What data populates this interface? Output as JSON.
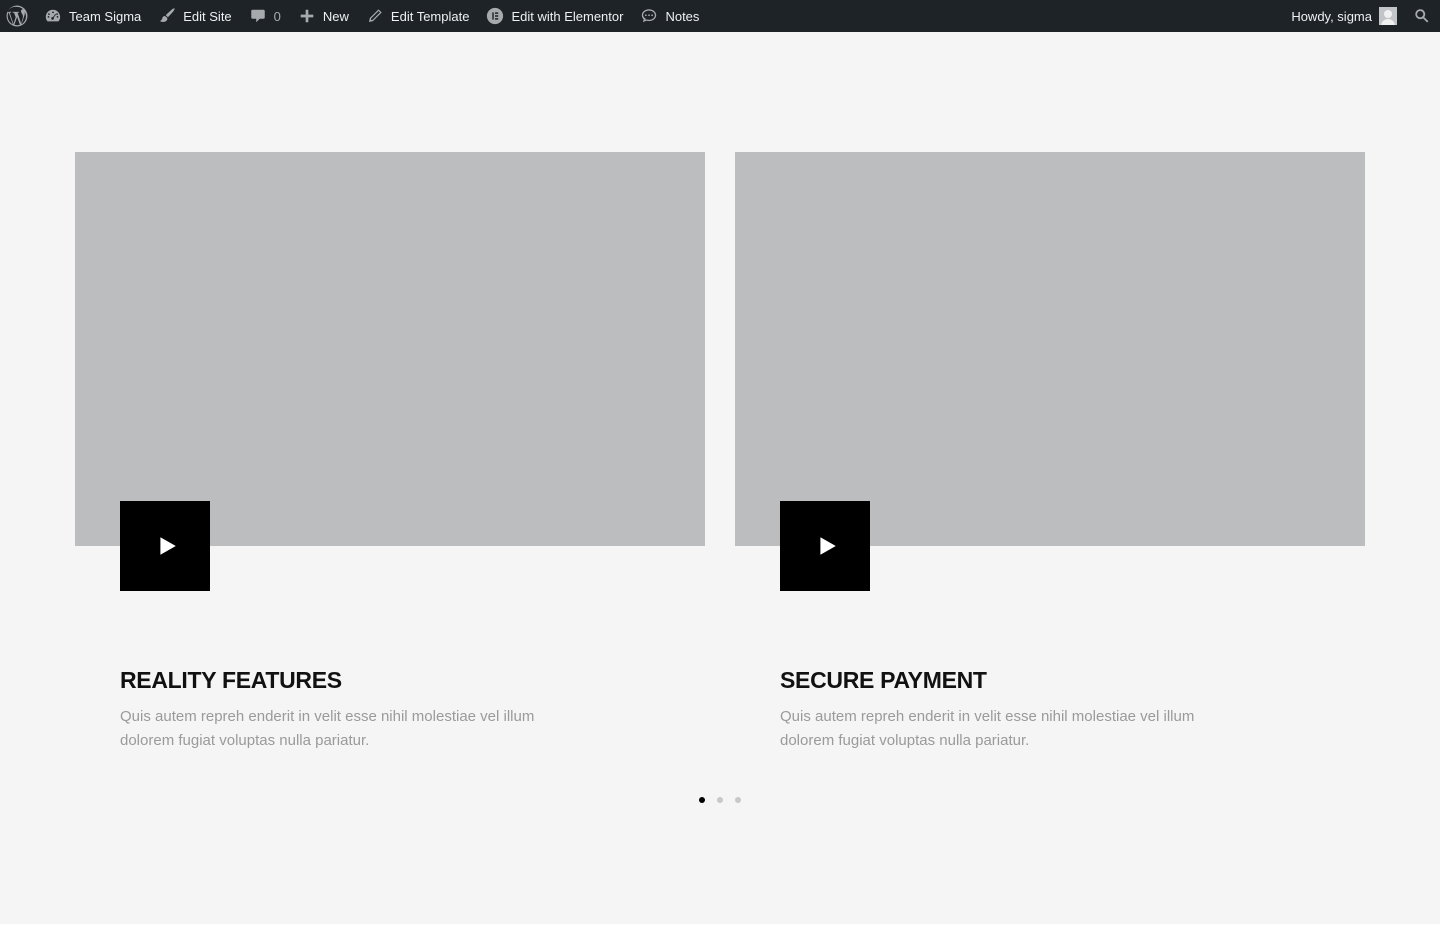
{
  "adminbar": {
    "site_name": "Team Sigma",
    "edit_site": "Edit Site",
    "comments_count": "0",
    "new_label": "New",
    "edit_template": "Edit Template",
    "edit_elementor": "Edit with Elementor",
    "notes": "Notes",
    "howdy": "Howdy, sigma",
    "icons": {
      "logo": "wordpress-logo-icon",
      "site": "dashboard-gauge-icon",
      "edit_site": "paintbrush-icon",
      "comments": "speech-bubble-icon",
      "new": "plus-icon",
      "edit_template": "pencil-icon",
      "elementor": "elementor-logo-icon",
      "notes": "chat-bubble-icon",
      "search": "search-icon"
    },
    "bg_color": "#1d2327",
    "text_color": "#f0f0f1"
  },
  "page": {
    "bg_color": "#f5f5f5",
    "cards": [
      {
        "title": "REALITY FEATURES",
        "text": "Quis autem repreh enderit in velit esse nihil molestiae vel illum dolorem fugiat voluptas nulla pariatur.",
        "play_icon": "play-icon"
      },
      {
        "title": "SECURE PAYMENT",
        "text": "Quis autem repreh enderit in velit esse nihil molestiae vel illum dolorem fugiat voluptas nulla pariatur.",
        "play_icon": "play-icon"
      }
    ],
    "pagination": {
      "total": 3,
      "active_index": 0
    }
  }
}
